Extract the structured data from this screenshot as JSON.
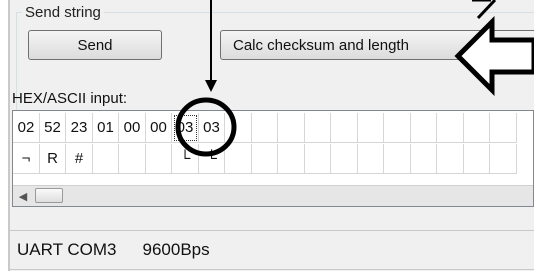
{
  "group": {
    "title": "Send string"
  },
  "buttons": {
    "send": "Send",
    "calc": "Calc checksum and length"
  },
  "input": {
    "label": "HEX/ASCII input:",
    "hex": [
      "02",
      "52",
      "23",
      "01",
      "00",
      "00",
      "03",
      "03",
      "",
      "",
      "",
      "",
      "",
      "",
      "",
      "",
      "",
      "",
      ""
    ],
    "ascii": [
      "¬",
      "R",
      "#",
      "",
      "",
      "",
      "└",
      "└",
      "",
      "",
      "",
      "",
      "",
      "",
      "",
      "",
      "",
      "",
      ""
    ]
  },
  "status": {
    "port": "UART COM3",
    "baud": "9600Bps"
  },
  "icons": {
    "scroll_left": "scroll-left-arrow-icon",
    "annotation_arrow": "hollow-left-arrow-icon"
  }
}
